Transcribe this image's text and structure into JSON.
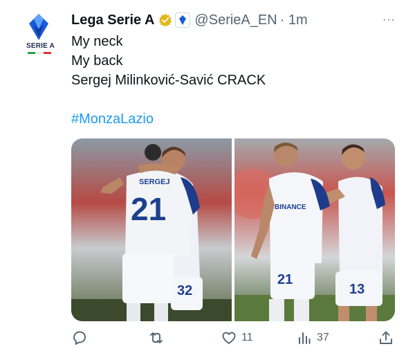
{
  "tweet": {
    "author_name": "Lega Serie A",
    "handle": "@SerieA_EN",
    "time": "· 1m",
    "more_label": "···",
    "avatar_text": "SERIE A",
    "lines": [
      "My neck",
      "My back",
      "Sergej Milinković-Savić CRACK"
    ],
    "hashtag": "#MonzaLazio"
  },
  "media": {
    "photos": [
      {
        "name_on_shirt": "SERGEJ",
        "number": "21",
        "other_number": "32"
      },
      {
        "sponsor": "BINANCE",
        "number": "21",
        "other_number": "13"
      }
    ]
  },
  "actions": {
    "reply_count": "",
    "retweet_count": "",
    "like_count": "11",
    "views_count": "37"
  },
  "colors": {
    "accent": "#1d9bf0",
    "text": "#0f1419",
    "muted": "#536471",
    "verified_gold": "#e2b719",
    "serie_a_blue": "#1a5bd8"
  }
}
